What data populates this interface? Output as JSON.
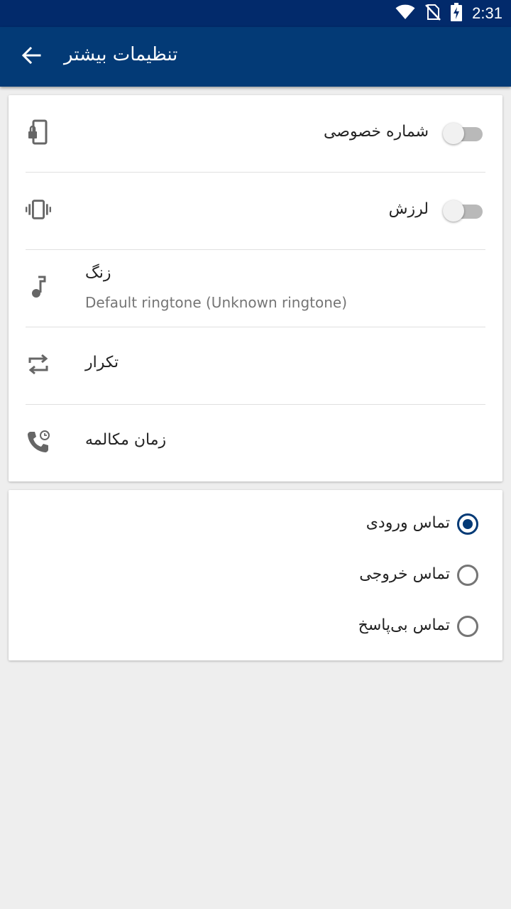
{
  "status_bar": {
    "time": "2:31",
    "icons": [
      "wifi-icon",
      "no-sim-icon",
      "battery-charging-icon"
    ],
    "background": "#022a6b"
  },
  "app_bar": {
    "title": "تنظیمات بیشتر",
    "back_icon": "arrow-back-icon",
    "background": "#033a76"
  },
  "settings": {
    "private_number": {
      "label": "شماره خصوصی",
      "icon": "phone-lock-icon",
      "enabled": false
    },
    "vibration": {
      "label": "لرزش",
      "icon": "vibration-icon",
      "enabled": false
    },
    "ringtone": {
      "label": "زنگ",
      "value": "Default ringtone (Unknown ringtone)",
      "icon": "music-note-icon"
    },
    "repeat": {
      "label": "تکرار",
      "icon": "repeat-icon"
    },
    "call_time": {
      "label": "زمان مکالمه",
      "icon": "phone-clock-icon"
    }
  },
  "call_type": {
    "options": [
      {
        "label": "تماس ورودی",
        "selected": true
      },
      {
        "label": "تماس خروجی",
        "selected": false
      },
      {
        "label": "تماس بی‌پاسخ",
        "selected": false
      }
    ],
    "accent": "#033a76"
  }
}
